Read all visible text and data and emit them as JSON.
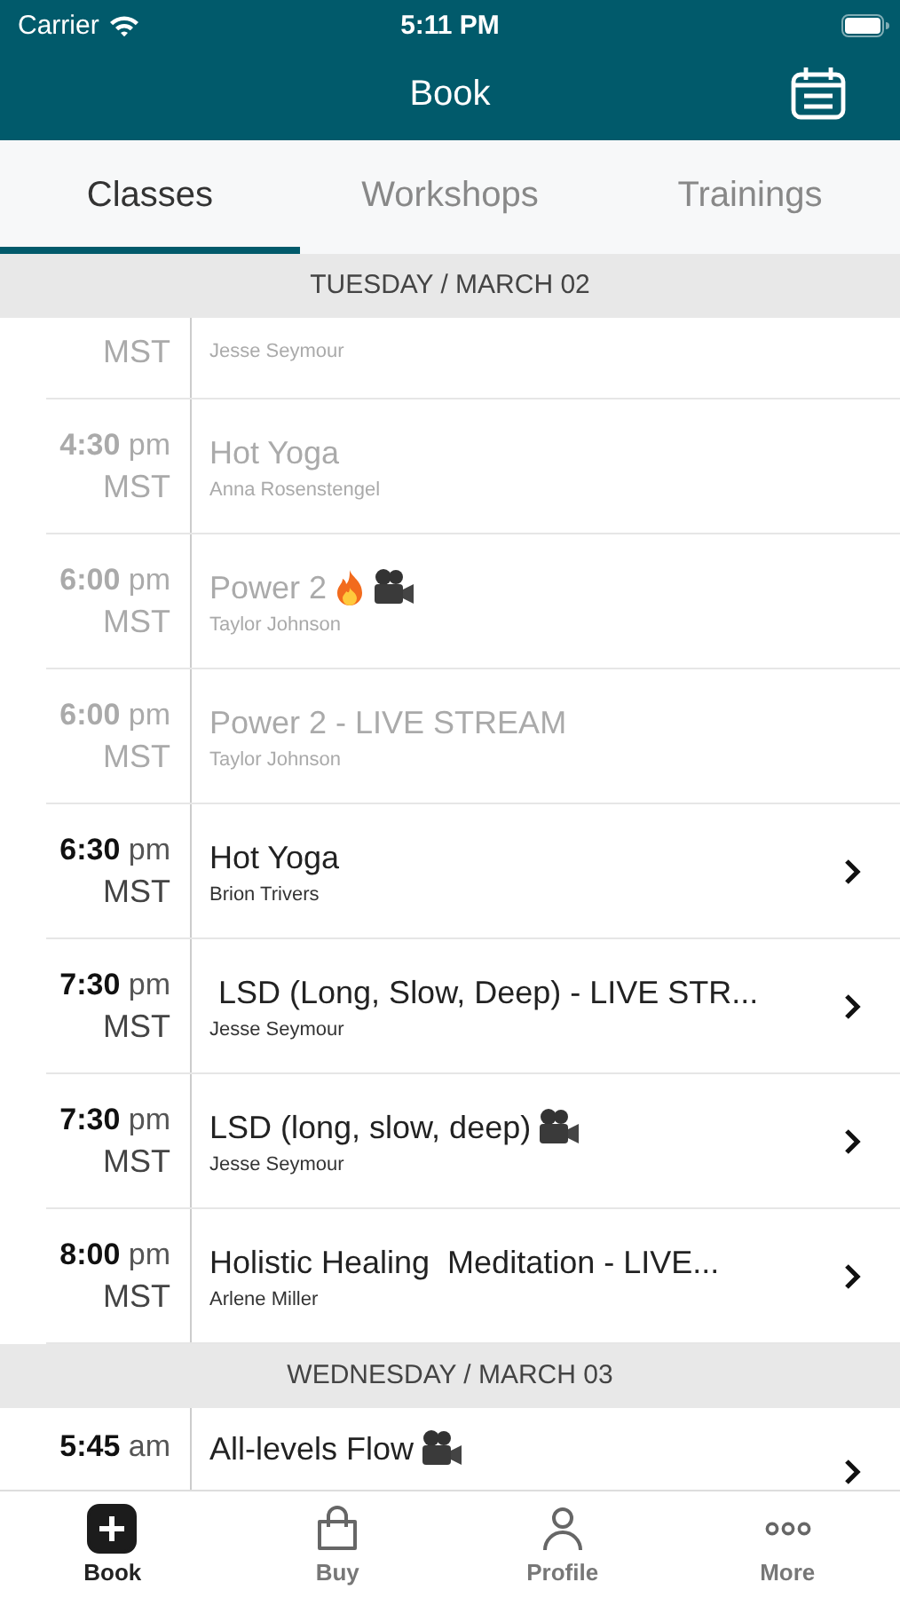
{
  "status_bar": {
    "carrier": "Carrier",
    "time": "5:11 PM"
  },
  "nav": {
    "title": "Book"
  },
  "tabs": [
    {
      "label": "Classes",
      "selected": true
    },
    {
      "label": "Workshops",
      "selected": false
    },
    {
      "label": "Trainings",
      "selected": false
    }
  ],
  "sections": [
    {
      "header": "TUESDAY / MARCH 02",
      "rows": [
        {
          "kind": "cut_top",
          "zone": "MST",
          "instructor": "Jesse Seymour",
          "past": true
        },
        {
          "kind": "full",
          "time": "4:30",
          "meridiem": "pm",
          "zone": "MST",
          "title": "Hot Yoga",
          "instructor": "Anna Rosenstengel",
          "past": true,
          "hot": false,
          "video": false
        },
        {
          "kind": "full",
          "time": "6:00",
          "meridiem": "pm",
          "zone": "MST",
          "title": "Power 2",
          "instructor": "Taylor Johnson",
          "past": true,
          "hot": true,
          "video": true
        },
        {
          "kind": "full",
          "time": "6:00",
          "meridiem": "pm",
          "zone": "MST",
          "title": "Power 2 - LIVE STREAM",
          "instructor": "Taylor Johnson",
          "past": true,
          "hot": false,
          "video": false
        },
        {
          "kind": "full",
          "time": "6:30",
          "meridiem": "pm",
          "zone": "MST",
          "title": "Hot Yoga",
          "instructor": "Brion Trivers",
          "past": false,
          "hot": false,
          "video": false
        },
        {
          "kind": "full",
          "time": "7:30",
          "meridiem": "pm",
          "zone": "MST",
          "title": " LSD (Long, Slow, Deep) - LIVE STR...",
          "instructor": "Jesse Seymour",
          "past": false,
          "hot": false,
          "video": false
        },
        {
          "kind": "full",
          "time": "7:30",
          "meridiem": "pm",
          "zone": "MST",
          "title": "LSD (long, slow, deep)",
          "instructor": "Jesse Seymour",
          "past": false,
          "hot": false,
          "video": true
        },
        {
          "kind": "full",
          "time": "8:00",
          "meridiem": "pm",
          "zone": "MST",
          "title": "Holistic Healing  Meditation - LIVE...",
          "instructor": "Arlene Miller",
          "past": false,
          "hot": false,
          "video": false
        }
      ]
    },
    {
      "header": "WEDNESDAY / MARCH 03",
      "rows": [
        {
          "kind": "cut_bottom",
          "time": "5:45",
          "meridiem": "am",
          "title": "All-levels Flow",
          "past": false,
          "hot": false,
          "video": true
        }
      ]
    }
  ],
  "tab_bar": [
    {
      "label": "Book",
      "kind": "book",
      "selected": true
    },
    {
      "label": "Buy",
      "kind": "buy",
      "selected": false
    },
    {
      "label": "Profile",
      "kind": "profile",
      "selected": false
    },
    {
      "label": "More",
      "kind": "more",
      "selected": false
    }
  ]
}
